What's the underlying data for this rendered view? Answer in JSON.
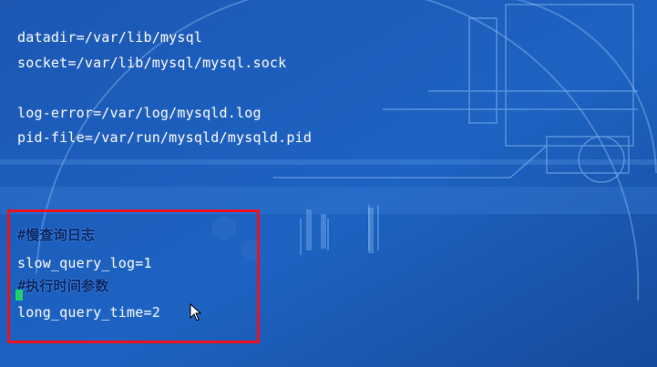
{
  "config": {
    "lines": [
      "datadir=/var/lib/mysql",
      "socket=/var/lib/mysql/mysql.sock",
      "log-error=/var/log/mysqld.log",
      "pid-file=/var/run/mysqld/mysqld.pid"
    ],
    "highlighted": {
      "comment1": "#慢查询日志",
      "setting1": "slow_query_log=1",
      "comment2": "#执行时间参数",
      "setting2": "long_query_time=2"
    }
  },
  "colors": {
    "background": "#1a55b0",
    "text": "#e8eef8",
    "highlight_border": "#e8131f",
    "cursor": "#1fd06a"
  },
  "icons": [
    "mouse-pointer-icon"
  ]
}
